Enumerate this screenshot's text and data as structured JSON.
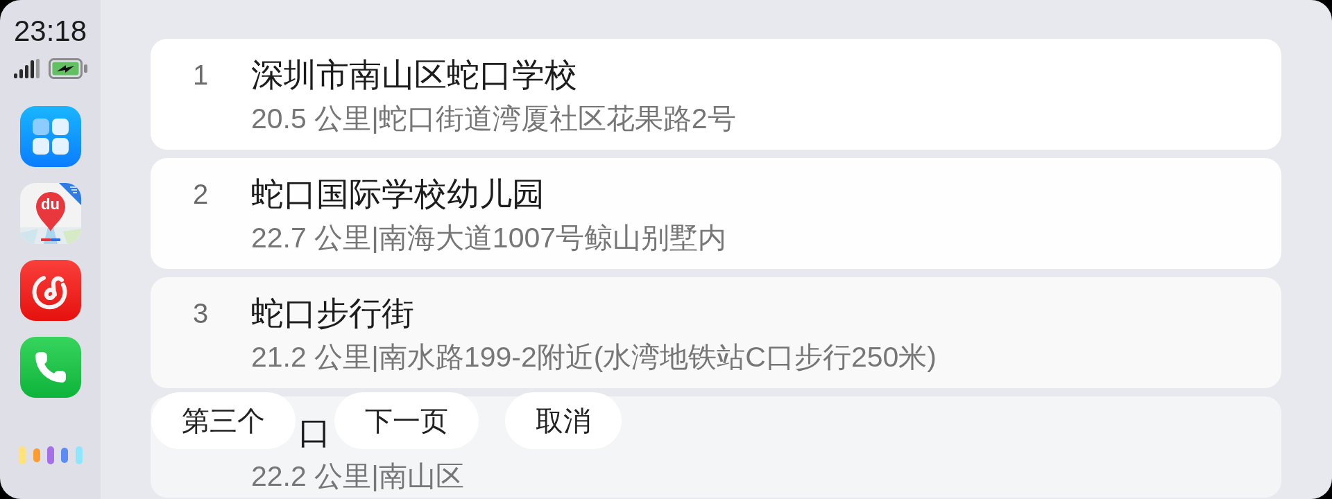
{
  "status": {
    "time": "23:18"
  },
  "dock": {
    "apps": [
      {
        "kind": "app_grid"
      },
      {
        "kind": "map",
        "logo_text": "du"
      },
      {
        "kind": "music"
      },
      {
        "kind": "phone"
      }
    ]
  },
  "results": [
    {
      "kind": "result",
      "number": "1",
      "title": "深圳市南山区蛇口学校",
      "detail": "20.5 公里|蛇口街道湾厦社区花果路2号"
    },
    {
      "kind": "result",
      "number": "2",
      "title": "蛇口国际学校幼儿园",
      "detail": "22.7 公里|南海大道1007号鲸山别墅内"
    },
    {
      "kind": "result",
      "number": "3",
      "title": "蛇口步行街",
      "detail": "21.2 公里|南水路199-2附近(水湾地铁站C口步行250米)"
    },
    {
      "kind": "covered",
      "title": "口",
      "detail": "22.2 公里|南山区"
    }
  ],
  "actions": [
    "第三个",
    "下一页",
    "取消"
  ]
}
